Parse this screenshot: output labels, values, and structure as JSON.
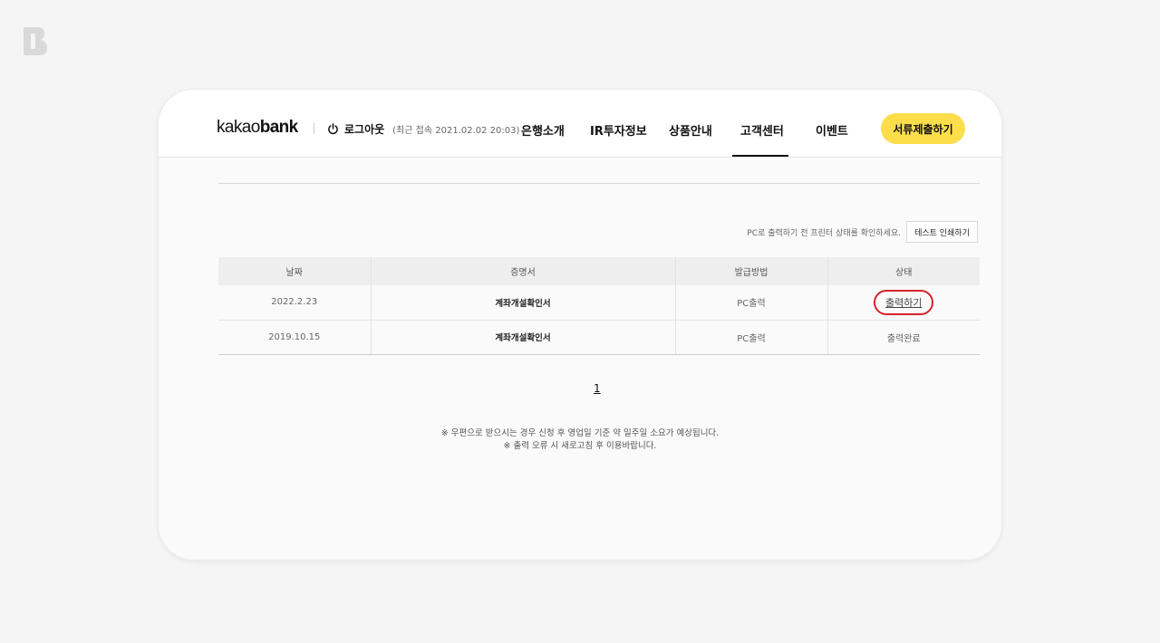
{
  "header": {
    "brand_light": "kakao",
    "brand_bold": "bank",
    "logout_label": "로그아웃",
    "last_login": "(최근 접속 2021.02.02 20:03)",
    "nav": [
      "은행소개",
      "IR투자정보",
      "상품안내",
      "고객센터",
      "이벤트"
    ],
    "active_nav": "고객센터",
    "cta_label": "서류제출하기"
  },
  "notice": {
    "text": "PC로 출력하기 전 프린터 상태를 확인하세요.",
    "test_print_label": "테스트 인쇄하기"
  },
  "table": {
    "headers": [
      "날짜",
      "증명서",
      "발급방법",
      "상태"
    ],
    "rows": [
      {
        "date": "2022.2.23",
        "certificate": "계좌개설확인서",
        "method": "PC출력",
        "status": "출력하기"
      },
      {
        "date": "2019.10.15",
        "certificate": "계좌개설확인서",
        "method": "PC출력",
        "status": "출력완료"
      }
    ]
  },
  "pagination": {
    "current": "1"
  },
  "footnotes": [
    "※ 우편으로 받으시는 경우 신청 후 영업일 기준 약 일주일 소요가 예상됩니다.",
    "※ 출력 오류 시 새로고침 후 이용바랍니다."
  ],
  "colors": {
    "accent_yellow": "#fcde4b",
    "highlight_red": "#d8232a"
  },
  "icons": {
    "corner_logo": "brunch-b-logo",
    "logout": "power-icon"
  }
}
